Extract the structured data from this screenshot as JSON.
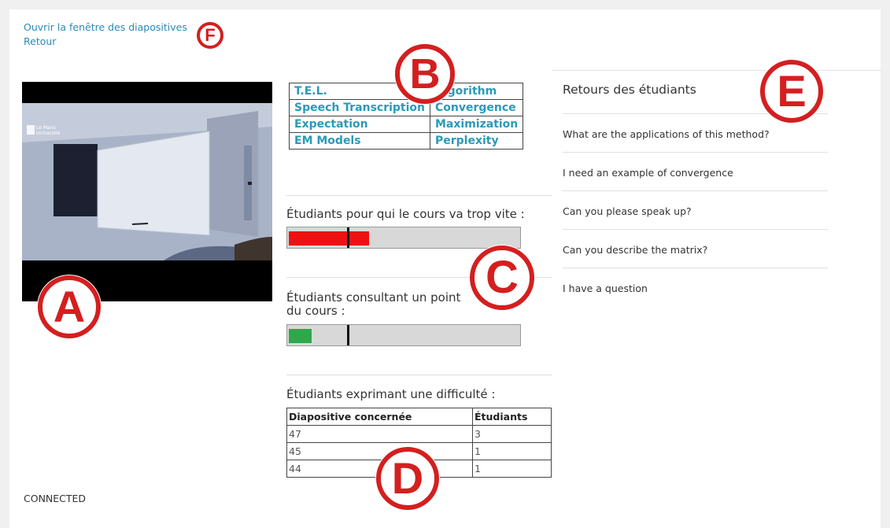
{
  "links": {
    "open_slides": "Ouvrir la fenêtre des diapositives",
    "back": "Retour"
  },
  "video": {
    "logo_text": "Le Mans Université"
  },
  "keywords": [
    [
      "T.E.L.",
      "Algorithm"
    ],
    [
      "Speech Transcription",
      "Convergence"
    ],
    [
      "Expectation",
      "Maximization"
    ],
    [
      "EM Models",
      "Perplexity"
    ]
  ],
  "bars": {
    "too_fast": {
      "label": "Étudiants pour qui le cours va trop vite :",
      "fill_fraction": 0.35,
      "marker_fraction": 0.26,
      "fill_color": "#ee1111"
    },
    "consulting": {
      "label": "Étudiants consultant un point",
      "label_line2": "du cours :",
      "fill_fraction": 0.1,
      "marker_fraction": 0.26,
      "fill_color": "#2ea84a"
    }
  },
  "difficulty": {
    "title": "Étudiants exprimant une difficulté :",
    "headers": [
      "Diapositive concernée",
      "Étudiants"
    ],
    "rows": [
      [
        "47",
        "3"
      ],
      [
        "45",
        "1"
      ],
      [
        "44",
        "1"
      ]
    ]
  },
  "feedback": {
    "title": "Retours des étudiants",
    "items": [
      "What are the applications of this method?",
      "I need an example of convergence",
      "Can you please speak up?",
      "Can you describe the matrix?",
      "I have a question"
    ]
  },
  "status": "CONNECTED",
  "badges": {
    "a": "A",
    "b": "B",
    "c": "C",
    "d": "D",
    "e": "E",
    "f": "F",
    "color": "#d41f1f"
  }
}
